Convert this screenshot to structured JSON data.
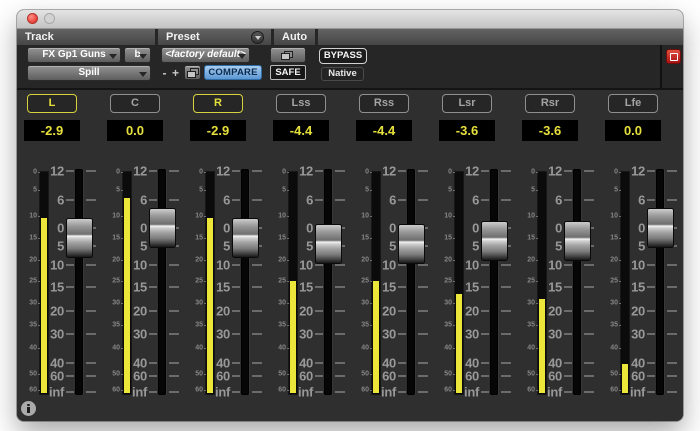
{
  "header": {
    "track": {
      "label": "Track",
      "track_name": "FX Gp1 Guns",
      "insert_letter": "b",
      "plugin_name": "Spill"
    },
    "preset": {
      "label": "Preset",
      "preset_name": "<factory default>",
      "minus_label": "-",
      "plus_label": "+",
      "compare_label": "COMPARE"
    },
    "auto": {
      "label": "Auto",
      "safe_label": "SAFE"
    },
    "bypass_label": "BYPASS",
    "processing_label": "Native"
  },
  "fader_scale_labels": [
    "12",
    "6",
    "0",
    "5",
    "10",
    "15",
    "20",
    "30",
    "40",
    "60",
    "inf"
  ],
  "meter_scale_labels": [
    "0",
    "5",
    "10",
    "15",
    "20",
    "25",
    "30",
    "35",
    "40",
    "50",
    "60"
  ],
  "channels": [
    {
      "label": "L",
      "selected": true,
      "gain_display": "-2.9",
      "gain_db": -2.9,
      "meter_db": -10.5
    },
    {
      "label": "C",
      "selected": false,
      "gain_display": "0.0",
      "gain_db": 0.0,
      "meter_db": -6.5
    },
    {
      "label": "R",
      "selected": true,
      "gain_display": "-2.9",
      "gain_db": -2.9,
      "meter_db": -10.5
    },
    {
      "label": "Lss",
      "selected": false,
      "gain_display": "-4.4",
      "gain_db": -4.4,
      "meter_db": -25
    },
    {
      "label": "Rss",
      "selected": false,
      "gain_display": "-4.4",
      "gain_db": -4.4,
      "meter_db": -25
    },
    {
      "label": "Lsr",
      "selected": false,
      "gain_display": "-3.6",
      "gain_db": -3.6,
      "meter_db": -28
    },
    {
      "label": "Rsr",
      "selected": false,
      "gain_display": "-3.6",
      "gain_db": -3.6,
      "meter_db": -29
    },
    {
      "label": "Lfe",
      "selected": false,
      "gain_display": "0.0",
      "gain_db": 0.0,
      "meter_db": -46
    }
  ],
  "colors": {
    "accent_yellow": "#e6e03c",
    "compare_blue": "#6fa8dc",
    "target_red": "#c42b1c"
  },
  "icons": {
    "titlebar": [
      "close-icon",
      "minimize-icon"
    ],
    "header": [
      "preset-menu-icon",
      "copy-preset-icon",
      "auto-window-icon",
      "plugin-target-icon"
    ],
    "footer": [
      "info-icon"
    ]
  }
}
